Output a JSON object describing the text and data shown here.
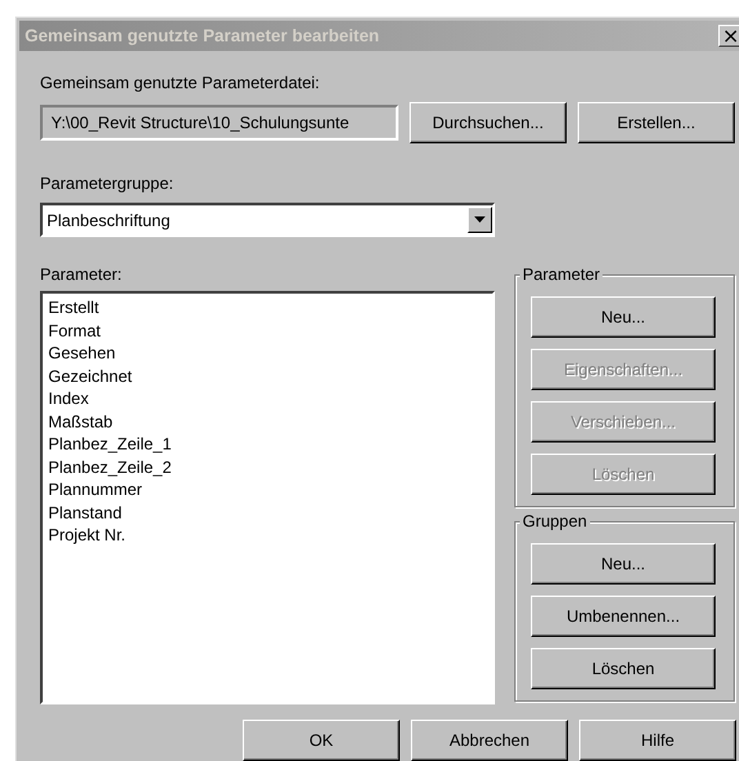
{
  "window": {
    "title": "Gemeinsam genutzte Parameter bearbeiten",
    "close": "×"
  },
  "file": {
    "label": "Gemeinsam genutzte Parameterdatei:",
    "value": "Y:\\00_Revit Structure\\10_Schulungsunte",
    "buttons": [
      {
        "label": "Durchsuchen...",
        "disabled": false
      },
      {
        "label": "Erstellen...",
        "disabled": false
      }
    ]
  },
  "group": {
    "label": "Parametergruppe:",
    "value": "Planbeschriftung"
  },
  "parameters": {
    "label": "Parameter:",
    "items": [
      {
        "label": "Erstellt",
        "selected": false
      },
      {
        "label": "Format",
        "selected": false
      },
      {
        "label": "Gesehen",
        "selected": false
      },
      {
        "label": "Gezeichnet",
        "selected": false
      },
      {
        "label": "Index",
        "selected": false
      },
      {
        "label": "Maßstab",
        "selected": false
      },
      {
        "label": "Planbez_Zeile_1",
        "selected": false
      },
      {
        "label": "Planbez_Zeile_2",
        "selected": false
      },
      {
        "label": "Plannummer",
        "selected": false
      },
      {
        "label": "Planstand",
        "selected": false
      },
      {
        "label": "Projekt Nr.",
        "selected": false
      }
    ]
  },
  "parameter_box": {
    "title": "Parameter",
    "buttons": [
      {
        "label": "Neu...",
        "disabled": false
      },
      {
        "label": "Eigenschaften...",
        "disabled": true
      },
      {
        "label": "Verschieben...",
        "disabled": true
      },
      {
        "label": "Löschen",
        "disabled": true
      }
    ]
  },
  "groups_box": {
    "title": "Gruppen",
    "buttons": [
      {
        "label": "Neu...",
        "disabled": false
      },
      {
        "label": "Umbenennen...",
        "disabled": false
      },
      {
        "label": "Löschen",
        "disabled": false
      }
    ]
  },
  "footer_buttons": [
    {
      "label": "OK",
      "disabled": false
    },
    {
      "label": "Abbrechen",
      "disabled": false
    },
    {
      "label": "Hilfe",
      "disabled": false
    }
  ]
}
